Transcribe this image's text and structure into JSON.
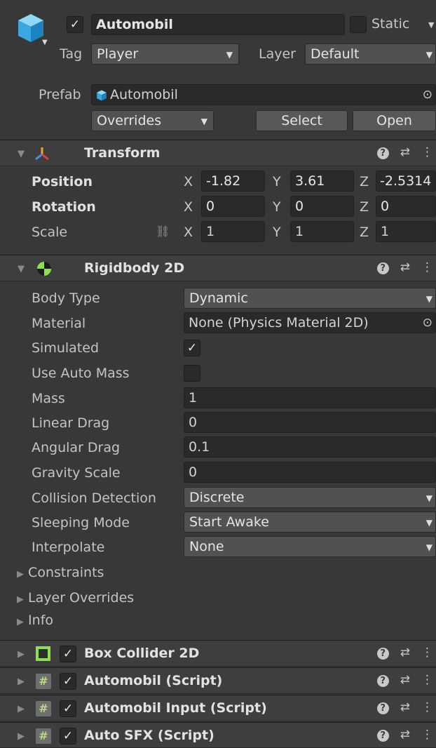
{
  "object": {
    "name": "Automobil",
    "active_checked": "✓",
    "static_label": "Static",
    "tag_label": "Tag",
    "tag_value": "Player",
    "layer_label": "Layer",
    "layer_value": "Default"
  },
  "prefab": {
    "label": "Prefab",
    "value": "Automobil",
    "overrides_label": "Overrides",
    "select_label": "Select",
    "open_label": "Open"
  },
  "transform": {
    "title": "Transform",
    "position": {
      "label": "Position",
      "x": "-1.82",
      "y": "3.61",
      "z": "-2.5314"
    },
    "rotation": {
      "label": "Rotation",
      "x": "0",
      "y": "0",
      "z": "0"
    },
    "scale": {
      "label": "Scale",
      "x": "1",
      "y": "1",
      "z": "1"
    },
    "axis_x": "X",
    "axis_y": "Y",
    "axis_z": "Z"
  },
  "rigidbody": {
    "title": "Rigidbody 2D",
    "body_type": {
      "label": "Body Type",
      "value": "Dynamic"
    },
    "material": {
      "label": "Material",
      "value": "None (Physics Material 2D)"
    },
    "simulated": {
      "label": "Simulated",
      "value": "✓"
    },
    "use_auto_mass": {
      "label": "Use Auto Mass"
    },
    "mass": {
      "label": "Mass",
      "value": "1"
    },
    "linear_drag": {
      "label": "Linear Drag",
      "value": "0"
    },
    "angular_drag": {
      "label": "Angular Drag",
      "value": "0.1"
    },
    "gravity_scale": {
      "label": "Gravity Scale",
      "value": "0"
    },
    "collision_detection": {
      "label": "Collision Detection",
      "value": "Discrete"
    },
    "sleeping_mode": {
      "label": "Sleeping Mode",
      "value": "Start Awake"
    },
    "interpolate": {
      "label": "Interpolate",
      "value": "None"
    },
    "constraints_label": "Constraints",
    "layer_overrides_label": "Layer Overrides",
    "info_label": "Info"
  },
  "components": [
    {
      "title": "Box Collider 2D"
    },
    {
      "title": "Automobil (Script)"
    },
    {
      "title": "Automobil Input (Script)"
    },
    {
      "title": "Auto SFX (Script)"
    }
  ],
  "glyphs": {
    "check": "✓",
    "hash": "#",
    "help": "?",
    "arrow_down": "▼",
    "fold_right": "▶",
    "fold_down": "▼"
  },
  "colors": {
    "background": "#383838",
    "field": "#2a2a2a",
    "header": "#3e3e3e",
    "prefab_blue": "#4fb8e8",
    "collider_green": "#8be04e"
  }
}
